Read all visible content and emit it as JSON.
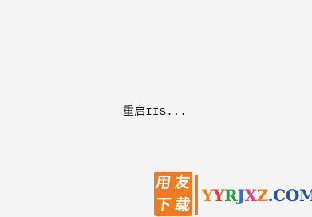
{
  "status": {
    "message": "重启IIS..."
  },
  "watermark": {
    "badge_chars": [
      "用",
      "友",
      "下",
      "载"
    ],
    "url_parts": [
      "Y",
      "Y",
      "R",
      "J",
      "X",
      "Z",
      ".COM"
    ],
    "colors": {
      "badge": "#f07a1e",
      "url_orange": "#f07a1e",
      "url_red": "#e8392f",
      "url_green": "#2f9e3a",
      "url_blue": "#2a6fd1",
      "url_pink": "#e0407a",
      "url_navy": "#2a4fa8"
    }
  },
  "colors": {
    "background": "#f4f4f4",
    "text": "#111111"
  }
}
